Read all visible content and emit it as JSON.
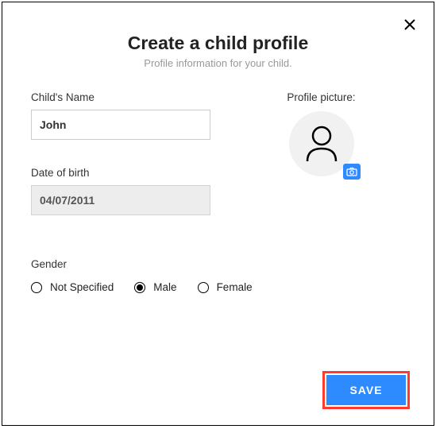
{
  "dialog": {
    "title": "Create a child profile",
    "subtitle": "Profile information for your child."
  },
  "fields": {
    "name_label": "Child's Name",
    "name_value": "John",
    "dob_label": "Date of birth",
    "dob_value": "04/07/2011",
    "profile_picture_label": "Profile picture:",
    "gender_label": "Gender"
  },
  "gender_options": {
    "not_specified": "Not Specified",
    "male": "Male",
    "female": "Female",
    "selected": "male"
  },
  "actions": {
    "save": "SAVE"
  },
  "icons": {
    "close": "close-icon",
    "avatar": "person-icon",
    "camera": "camera-icon"
  },
  "colors": {
    "accent": "#2e8bff",
    "highlight_border": "#ff3b30"
  }
}
